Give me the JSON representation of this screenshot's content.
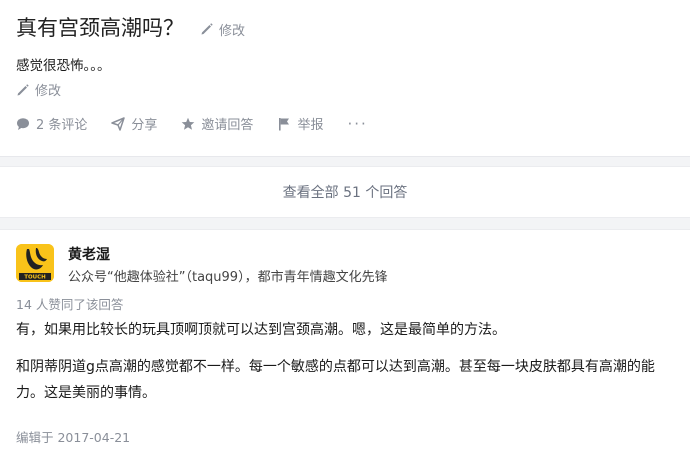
{
  "question": {
    "title": "真有宫颈高潮吗？",
    "title_edit_label": "修改",
    "detail": "感觉很恐怖。。。",
    "detail_edit_label": "修改",
    "actions": {
      "comments": "2 条评论",
      "share": "分享",
      "invite": "邀请回答",
      "report": "举报",
      "more": "···"
    }
  },
  "view_all": "查看全部 51 个回答",
  "answer": {
    "author_name": "黄老湿",
    "author_bio": "公众号“他趣体验社”（taqu99），都市青年情趣文化先锋",
    "avatar_text": "TOUCH",
    "votes": "14 人赞同了该回答",
    "paragraphs": [
      "有，如果用比较长的玩具顶啊顶就可以达到宫颈高潮。嗯，这是最简单的方法。",
      "和阴蒂阴道g点高潮的感觉都不一样。每一个敏感的点都可以达到高潮。甚至每一块皮肤都具有高潮的能力。这是美丽的事情。"
    ],
    "edited": "编辑于 2017-04-21"
  },
  "icons": [
    "pencil-icon",
    "comment-icon",
    "share-icon",
    "star-icon",
    "flag-icon",
    "more-icon"
  ],
  "colors": {
    "muted": "#8a8f99",
    "background": "#f3f4f6",
    "avatar": "#f9c31a"
  }
}
